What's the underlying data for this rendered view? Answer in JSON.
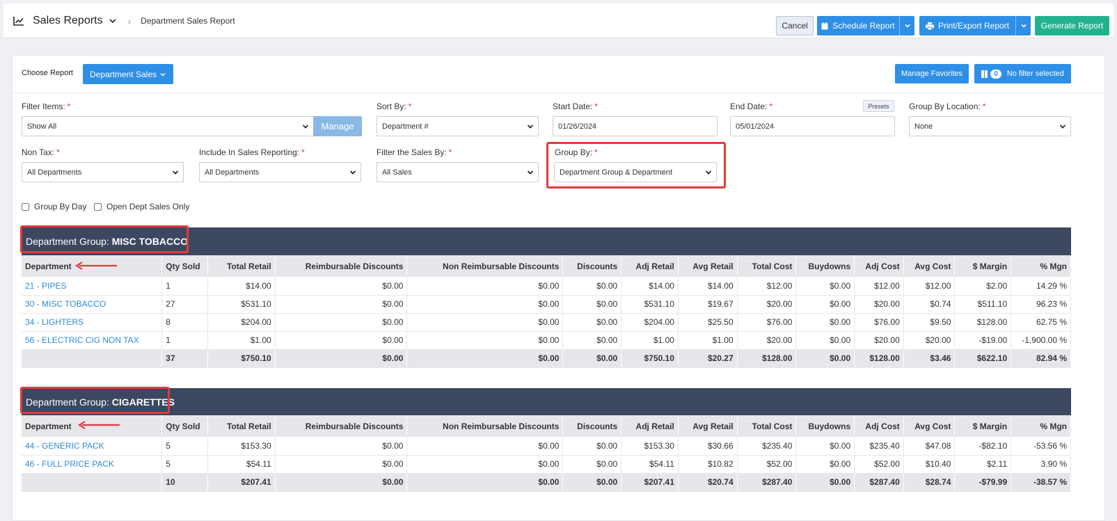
{
  "header": {
    "app_title": "Sales Reports",
    "breadcrumb": "Department Sales Report",
    "cancel_label": "Cancel",
    "schedule_label": "Schedule Report",
    "print_label": "Print/Export Report",
    "generate_label": "Generate Report"
  },
  "controls": {
    "choose_report_label": "Choose Report",
    "choose_report_value": "Department Sales",
    "manage_favorites_label": "Manage Favorites",
    "filter_count": "0",
    "no_filter_label": "No filter selected",
    "presets_label": "Presets",
    "manage_label": "Manage"
  },
  "filters": {
    "filter_items": {
      "label": "Filter Items:",
      "value": "Show All"
    },
    "sort_by": {
      "label": "Sort By:",
      "value": "Department #"
    },
    "start_date": {
      "label": "Start Date:",
      "value": "01/26/2024"
    },
    "end_date": {
      "label": "End Date:",
      "value": "05/01/2024"
    },
    "group_by_location": {
      "label": "Group By Location:",
      "value": "None"
    },
    "non_tax": {
      "label": "Non Tax:",
      "value": "All Departments"
    },
    "include_in_sales": {
      "label": "Include In Sales Reporting:",
      "value": "All Departments"
    },
    "filter_sales_by": {
      "label": "Filter the Sales By:",
      "value": "All Sales"
    },
    "group_by": {
      "label": "Group By:",
      "value": "Department Group & Department"
    },
    "required_mark": "*"
  },
  "checkboxes": {
    "group_by_day": "Group By Day",
    "open_dept_only": "Open Dept Sales Only"
  },
  "columns": [
    "Department",
    "Qty Sold",
    "Total Retail",
    "Reimbursable Discounts",
    "Non Reimbursable Discounts",
    "Discounts",
    "Adj Retail",
    "Avg Retail",
    "Total Cost",
    "Buydowns",
    "Adj Cost",
    "Avg Cost",
    "$ Margin",
    "% Mgn"
  ],
  "groups": [
    {
      "prefix": "Department Group:",
      "name": "MISC TOBACCO",
      "rows": [
        [
          "21 - PIPES",
          "1",
          "$14.00",
          "$0.00",
          "$0.00",
          "$0.00",
          "$14.00",
          "$14.00",
          "$12.00",
          "$0.00",
          "$12.00",
          "$12.00",
          "$2.00",
          "14.29 %"
        ],
        [
          "30 - MISC TOBACCO",
          "27",
          "$531.10",
          "$0.00",
          "$0.00",
          "$0.00",
          "$531.10",
          "$19.67",
          "$20.00",
          "$0.00",
          "$20.00",
          "$0.74",
          "$511.10",
          "96.23 %"
        ],
        [
          "34 - LIGHTERS",
          "8",
          "$204.00",
          "$0.00",
          "$0.00",
          "$0.00",
          "$204.00",
          "$25.50",
          "$76.00",
          "$0.00",
          "$76.00",
          "$9.50",
          "$128.00",
          "62.75 %"
        ],
        [
          "56 - ELECTRIC CIG NON TAX",
          "1",
          "$1.00",
          "$0.00",
          "$0.00",
          "$0.00",
          "$1.00",
          "$1.00",
          "$20.00",
          "$0.00",
          "$20.00",
          "$20.00",
          "-$19.00",
          "-1,900.00 %"
        ]
      ],
      "total": [
        "",
        "37",
        "$750.10",
        "$0.00",
        "$0.00",
        "$0.00",
        "$750.10",
        "$20.27",
        "$128.00",
        "$0.00",
        "$128.00",
        "$3.46",
        "$622.10",
        "82.94 %"
      ]
    },
    {
      "prefix": "Department Group:",
      "name": "CIGARETTES",
      "rows": [
        [
          "44 - GENERIC PACK",
          "5",
          "$153.30",
          "$0.00",
          "$0.00",
          "$0.00",
          "$153.30",
          "$30.66",
          "$235.40",
          "$0.00",
          "$235.40",
          "$47.08",
          "-$82.10",
          "-53.56 %"
        ],
        [
          "46 - FULL PRICE PACK",
          "5",
          "$54.11",
          "$0.00",
          "$0.00",
          "$0.00",
          "$54.11",
          "$10.82",
          "$52.00",
          "$0.00",
          "$52.00",
          "$10.40",
          "$2.11",
          "3.90 %"
        ]
      ],
      "total": [
        "",
        "10",
        "$207.41",
        "$0.00",
        "$0.00",
        "$0.00",
        "$207.41",
        "$20.74",
        "$287.40",
        "$0.00",
        "$287.40",
        "$28.74",
        "-$79.99",
        "-38.57 %"
      ]
    }
  ],
  "colors": {
    "primary": "#2e8fe6",
    "success": "#23b28e",
    "group_header": "#3c4760",
    "highlight": "#e23b3b",
    "link": "#2f8bd6"
  }
}
